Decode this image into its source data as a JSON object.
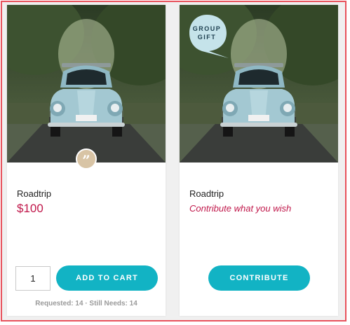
{
  "cards": [
    {
      "title": "Roadtrip",
      "price": "$100",
      "quantity": "1",
      "button_label": "ADD TO CART",
      "stats": "Requested: 14 · Still Needs: 14",
      "badge_icon": "quote-icon",
      "badge_text": "”"
    },
    {
      "title": "Roadtrip",
      "contribution_text": "Contribute what you wish",
      "button_label": "CONTRIBUTE",
      "badge_line1": "GROUP",
      "badge_line2": "GIFT"
    }
  ],
  "colors": {
    "accent": "#12b3c4",
    "price": "#c0174a",
    "badge_bubble": "#c5e3ea",
    "quote_badge": "#d8c4a5",
    "frame_border": "#e8525c"
  }
}
